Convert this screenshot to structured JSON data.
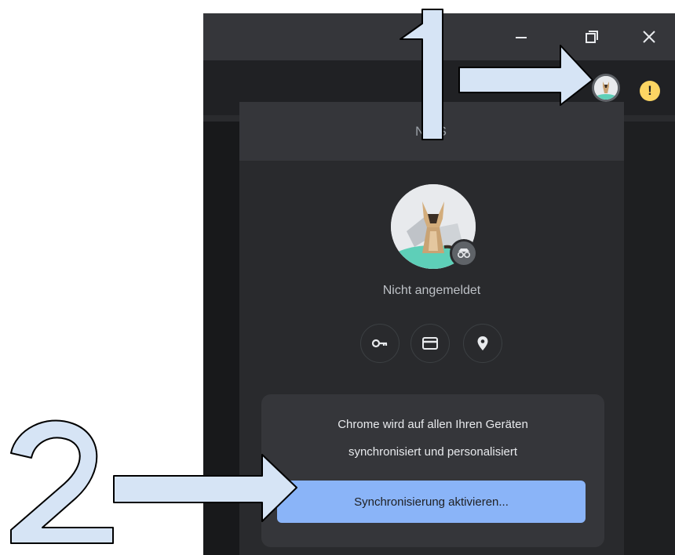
{
  "window": {
    "controls": {
      "minimize_icon": "minimize-icon",
      "restore_icon": "restore-icon",
      "close_icon": "close-icon"
    }
  },
  "toolbar": {
    "avatar_icon": "profile-avatar-icon",
    "alert_symbol": "!",
    "alert_color": "#fdd663"
  },
  "profile_menu": {
    "header_name": "NCS",
    "status": "Nicht angemeldet",
    "quick_actions": [
      {
        "icon": "key-icon"
      },
      {
        "icon": "credit-card-icon"
      },
      {
        "icon": "location-pin-icon"
      }
    ],
    "sync_card": {
      "line1": "Chrome wird auf allen Ihren Geräten",
      "line2": "synchronisiert und personalisiert",
      "button_label": "Synchronisierung aktivieren..."
    }
  },
  "annotations": {
    "step1": "1",
    "step2": "2",
    "arrow_fill": "#d6e4f5",
    "arrow_stroke": "#000000"
  },
  "colors": {
    "accent": "#8ab4f8",
    "menu_bg": "#292a2d",
    "window_bg": "#202124"
  }
}
